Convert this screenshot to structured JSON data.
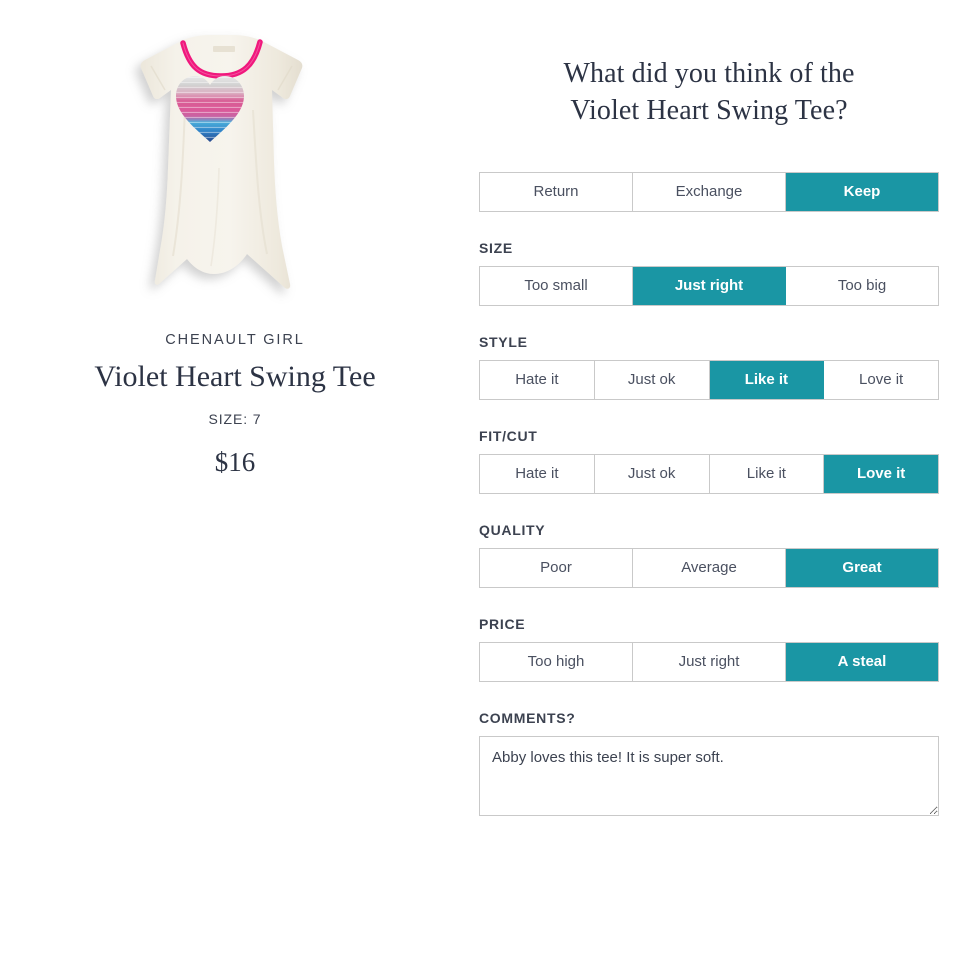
{
  "product": {
    "brand": "CHENAULT GIRL",
    "title": "Violet Heart Swing Tee",
    "size_label": "SIZE: 7",
    "price": "$16",
    "image_alt": "violet-heart-swing-tee"
  },
  "survey": {
    "heading_line1": "What did you think of the",
    "heading_line2": "Violet Heart Swing Tee?",
    "decision": {
      "options": [
        "Return",
        "Exchange",
        "Keep"
      ],
      "selected": "Keep"
    },
    "fields": [
      {
        "key": "size",
        "label": "SIZE",
        "options": [
          "Too small",
          "Just right",
          "Too big"
        ],
        "selected": "Just right"
      },
      {
        "key": "style",
        "label": "STYLE",
        "options": [
          "Hate it",
          "Just ok",
          "Like it",
          "Love it"
        ],
        "selected": "Like it"
      },
      {
        "key": "fitcut",
        "label": "FIT/CUT",
        "options": [
          "Hate it",
          "Just ok",
          "Like it",
          "Love it"
        ],
        "selected": "Love it"
      },
      {
        "key": "quality",
        "label": "QUALITY",
        "options": [
          "Poor",
          "Average",
          "Great"
        ],
        "selected": "Great"
      },
      {
        "key": "price",
        "label": "PRICE",
        "options": [
          "Too high",
          "Just right",
          "A steal"
        ],
        "selected": "A steal"
      }
    ],
    "comments": {
      "label": "COMMENTS?",
      "value": "Abby loves this tee! It is super soft.",
      "placeholder": ""
    }
  },
  "colors": {
    "accent_teal": "#1a96a4",
    "border_gray": "#c9c9c9",
    "text_dark": "#3c4250",
    "heading_dark": "#2c3344",
    "fabric_cream": "#f3efe6",
    "trim_pink": "#f0187d"
  }
}
